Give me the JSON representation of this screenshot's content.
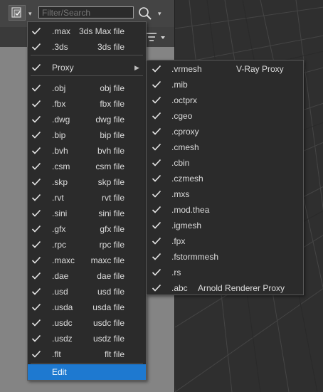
{
  "toolbar": {
    "search_placeholder": "Filter/Search",
    "dropdown_glyph": "▾"
  },
  "colors": {
    "highlight": "#1e79d0",
    "menu_bg": "#2b2b2b",
    "panel_gray": "#848484"
  },
  "icons": [
    "filter-icon",
    "search-icon",
    "sort-icon",
    "check-icon",
    "submenu-arrow-icon"
  ],
  "file_menu": {
    "items": [
      {
        "ext": ".max",
        "desc": "3ds Max file"
      },
      {
        "ext": ".3ds",
        "desc": "3ds file"
      },
      {
        "ext": "Proxy",
        "desc": ""
      },
      {
        "ext": ".obj",
        "desc": "obj file"
      },
      {
        "ext": ".fbx",
        "desc": "fbx file"
      },
      {
        "ext": ".dwg",
        "desc": "dwg file"
      },
      {
        "ext": ".bip",
        "desc": "bip file"
      },
      {
        "ext": ".bvh",
        "desc": "bvh file"
      },
      {
        "ext": ".csm",
        "desc": "csm file"
      },
      {
        "ext": ".skp",
        "desc": "skp file"
      },
      {
        "ext": ".rvt",
        "desc": "rvt file"
      },
      {
        "ext": ".sini",
        "desc": "sini file"
      },
      {
        "ext": ".gfx",
        "desc": "gfx file"
      },
      {
        "ext": ".rpc",
        "desc": "rpc file"
      },
      {
        "ext": ".maxc",
        "desc": "maxc file"
      },
      {
        "ext": ".dae",
        "desc": "dae file"
      },
      {
        "ext": ".usd",
        "desc": "usd file"
      },
      {
        "ext": ".usda",
        "desc": "usda file"
      },
      {
        "ext": ".usdc",
        "desc": "usdc file"
      },
      {
        "ext": ".usdz",
        "desc": "usdz file"
      },
      {
        "ext": ".flt",
        "desc": "flt file"
      }
    ],
    "edit_label": "Edit",
    "submenu_arrow": "▶"
  },
  "proxy_menu": {
    "items": [
      {
        "ext": ".vrmesh",
        "desc": "V-Ray Proxy"
      },
      {
        "ext": ".mib",
        "desc": ""
      },
      {
        "ext": ".octprx",
        "desc": ""
      },
      {
        "ext": ".cgeo",
        "desc": ""
      },
      {
        "ext": ".cproxy",
        "desc": ""
      },
      {
        "ext": ".cmesh",
        "desc": ""
      },
      {
        "ext": ".cbin",
        "desc": ""
      },
      {
        "ext": ".czmesh",
        "desc": ""
      },
      {
        "ext": ".mxs",
        "desc": ""
      },
      {
        "ext": ".mod.thea",
        "desc": ""
      },
      {
        "ext": ".igmesh",
        "desc": ""
      },
      {
        "ext": ".fpx",
        "desc": ""
      },
      {
        "ext": ".fstormmesh",
        "desc": ""
      },
      {
        "ext": ".rs",
        "desc": ""
      },
      {
        "ext": ".abc",
        "desc": "Arnold Renderer Proxy"
      }
    ]
  }
}
